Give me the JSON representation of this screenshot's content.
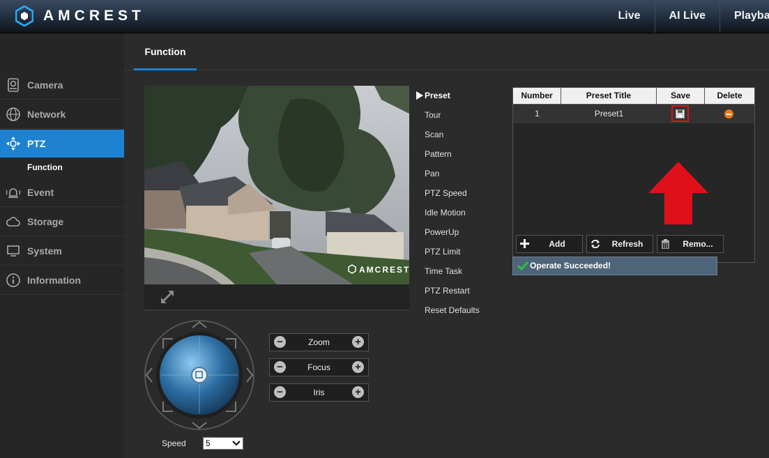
{
  "brand": {
    "name": "AMCREST"
  },
  "topnav": {
    "items": [
      "Live",
      "AI Live",
      "Playba"
    ]
  },
  "sidebar": {
    "items": [
      {
        "label": "Camera",
        "icon": "camera-icon"
      },
      {
        "label": "Network",
        "icon": "globe-icon"
      },
      {
        "label": "PTZ",
        "icon": "ptz-icon",
        "active": true
      },
      {
        "label": "Event",
        "icon": "alarm-icon"
      },
      {
        "label": "Storage",
        "icon": "cloud-icon"
      },
      {
        "label": "System",
        "icon": "monitor-icon"
      },
      {
        "label": "Information",
        "icon": "info-icon"
      }
    ],
    "sub_item": "Function"
  },
  "tabs": {
    "active": "Function"
  },
  "video": {
    "watermark": "AMCREST"
  },
  "lens": {
    "zoom": "Zoom",
    "focus": "Focus",
    "iris": "Iris"
  },
  "speed": {
    "label": "Speed",
    "value": "5"
  },
  "function_menu": {
    "items": [
      "Preset",
      "Tour",
      "Scan",
      "Pattern",
      "Pan",
      "PTZ Speed",
      "Idle Motion",
      "PowerUp",
      "PTZ Limit",
      "Time Task",
      "PTZ Restart",
      "Reset Defaults"
    ],
    "active": "Preset"
  },
  "preset_table": {
    "headers": [
      "Number",
      "Preset Title",
      "Save",
      "Delete"
    ],
    "rows": [
      {
        "number": "1",
        "title": "Preset1"
      }
    ]
  },
  "buttons": {
    "add": "Add",
    "refresh": "Refresh",
    "remove": "Remo..."
  },
  "status": {
    "message": "Operate Succeeded!"
  },
  "colors": {
    "accent": "#1e82d2",
    "highlight": "#e0101a",
    "delete": "#e8791d",
    "success": "#2fbf3f"
  }
}
